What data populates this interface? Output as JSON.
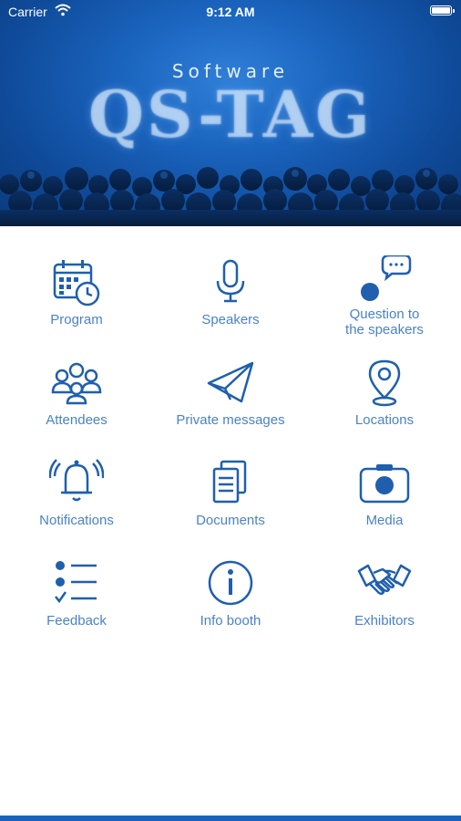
{
  "status_bar": {
    "carrier": "Carrier",
    "time": "9:12 AM"
  },
  "header": {
    "subtitle": "Software",
    "logo_text": "QS-TAG"
  },
  "menu": {
    "items": [
      {
        "label": "Program",
        "icon": "calendar-clock-icon"
      },
      {
        "label": "Speakers",
        "icon": "microphone-icon"
      },
      {
        "label": "Question to the speakers",
        "icon": "chat-bubble-person-icon"
      },
      {
        "label": "Attendees",
        "icon": "people-group-icon"
      },
      {
        "label": "Private messages",
        "icon": "paper-plane-icon"
      },
      {
        "label": "Locations",
        "icon": "map-pin-icon"
      },
      {
        "label": "Notifications",
        "icon": "bell-icon"
      },
      {
        "label": "Documents",
        "icon": "documents-icon"
      },
      {
        "label": "Media",
        "icon": "camera-icon"
      },
      {
        "label": "Feedback",
        "icon": "checklist-icon"
      },
      {
        "label": "Info booth",
        "icon": "info-icon"
      },
      {
        "label": "Exhibitors",
        "icon": "handshake-icon"
      }
    ]
  },
  "colors": {
    "accent": "#1a63bd",
    "label": "#4a82c8",
    "icon_fill": "#1f5fae"
  }
}
